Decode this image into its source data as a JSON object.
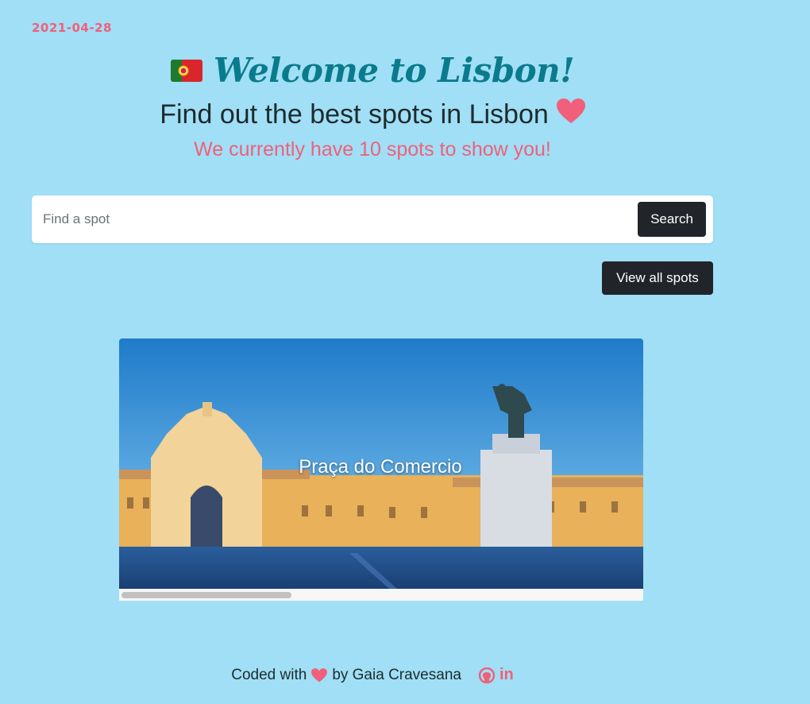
{
  "header": {
    "date": "2021-04-28",
    "title": "Welcome to Lisbon!",
    "subtitle": "Find out the best spots in Lisbon",
    "tagline": "We currently have 10 spots to show you!"
  },
  "search": {
    "placeholder": "Find a spot",
    "value": "",
    "button_label": "Search"
  },
  "view_all_label": "View all spots",
  "carousel": {
    "caption": "Praça do Comercio"
  },
  "footer": {
    "text_before": "Coded with",
    "text_after": "by Gaia Cravesana",
    "linkedin_label": "in"
  },
  "icons": {
    "flag": "portugal-flag-icon",
    "heart": "heart-icon",
    "github": "github-icon",
    "linkedin": "linkedin-icon"
  },
  "colors": {
    "background": "#a0dff6",
    "accent_pink": "#f0607a",
    "title_teal": "#0a7b8c",
    "button_dark": "#212529"
  }
}
